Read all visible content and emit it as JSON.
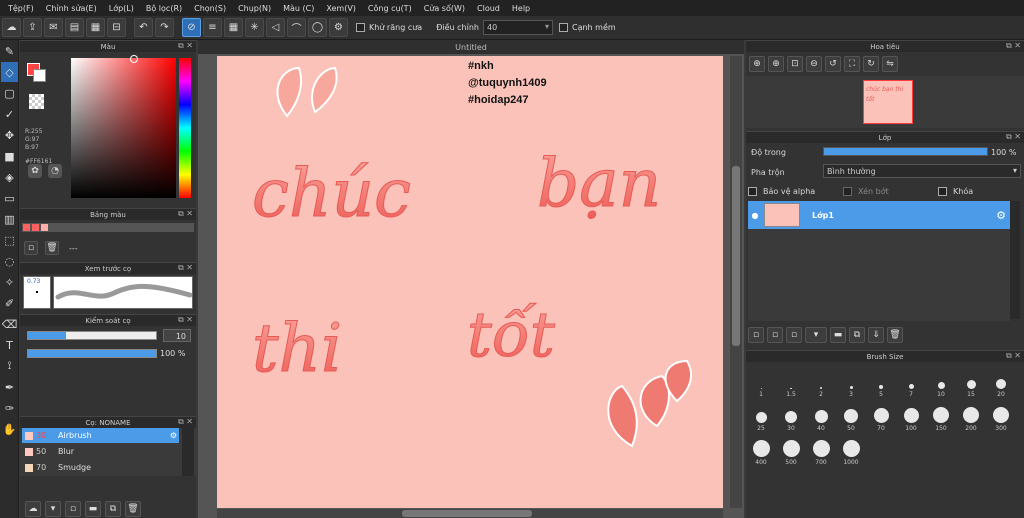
{
  "menu": [
    "Tệp(F)",
    "Chỉnh sửa(E)",
    "Lớp(L)",
    "Bộ lọc(R)",
    "Chọn(S)",
    "Chụp(N)",
    "Màu (C)",
    "Xem(V)",
    "Công cụ(T)",
    "Cửa số(W)",
    "Cloud",
    "Help"
  ],
  "toolbar": {
    "antialias_label": "Khử răng cưa",
    "adjust_label": "Điều chỉnh",
    "adjust_value": "40",
    "smooth_label": "Cạnh mềm"
  },
  "color_panel": {
    "title": "Màu",
    "r": "R:255",
    "g": "G:97",
    "b": "B:97",
    "hex": "#FF6161"
  },
  "palette_panel": {
    "title": "Bảng màu",
    "dashes": "---"
  },
  "brush_preview": {
    "title": "Xem trước cọ",
    "size": "0.73"
  },
  "brush_control": {
    "title": "Kiểm soát cọ",
    "size_value": "10",
    "size_fraction": 0.3,
    "opacity_value": "100 %",
    "opacity_fraction": 1.0
  },
  "brush_list": {
    "title": "Cọ: NONAME",
    "items": [
      {
        "size": "30",
        "name": "Airbrush",
        "selected": true
      },
      {
        "size": "50",
        "name": "Blur",
        "selected": false
      },
      {
        "size": "70",
        "name": "Smudge",
        "selected": false
      }
    ]
  },
  "document": {
    "title": "Untitled"
  },
  "canvas_text": {
    "line1": "#nkh",
    "line2": "@tuquynh1409",
    "line3": "#hoidap247",
    "word1": "chúc",
    "word2": "bạn",
    "word3": "thi",
    "word4": "tốt"
  },
  "navigator": {
    "title": "Hoa tiêu",
    "thumb_text": "chúc bạn thi tốt"
  },
  "layer_panel": {
    "title": "Lớp",
    "opacity_label": "Độ trong",
    "opacity_value": "100 %",
    "opacity_fraction": 1.0,
    "blend_label": "Pha trộn",
    "blend_value": "Bình thường",
    "protect_alpha": "Bảo vệ alpha",
    "clip": "Xén bớt",
    "lock": "Khóa",
    "layers": [
      {
        "name": "Lớp1"
      }
    ]
  },
  "brush_size": {
    "title": "Brush Size",
    "sizes": [
      "1",
      "1.5",
      "2",
      "3",
      "5",
      "7",
      "10",
      "15",
      "20",
      "25",
      "30",
      "40",
      "50",
      "70",
      "100",
      "150",
      "200",
      "300",
      "400",
      "500",
      "700",
      "1000"
    ]
  }
}
